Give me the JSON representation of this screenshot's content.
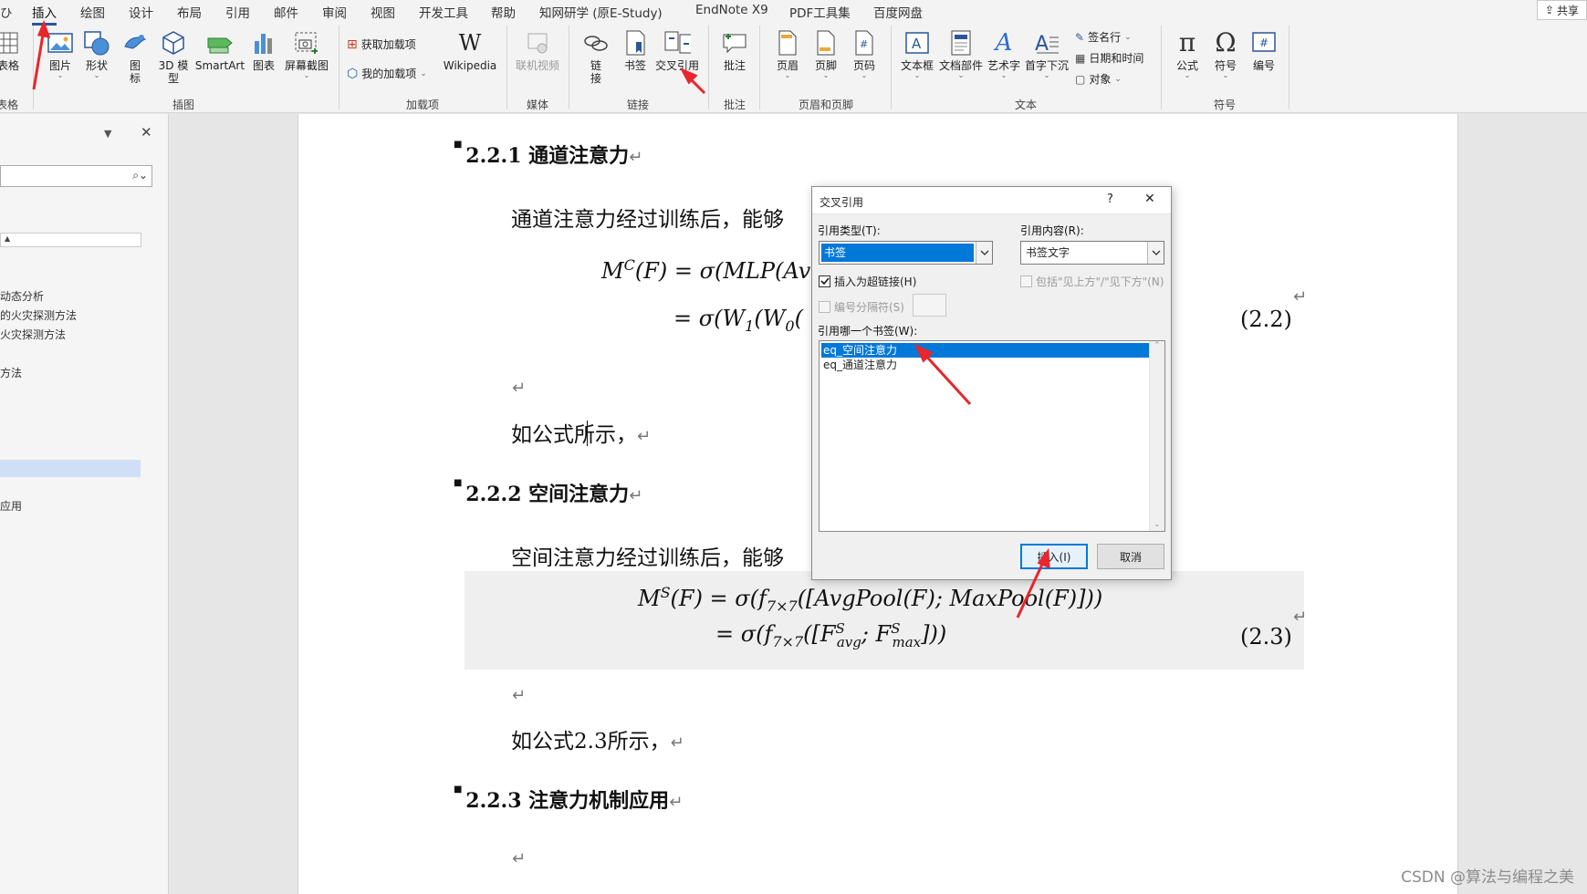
{
  "tabs": [
    "ひ",
    "插入",
    "绘图",
    "设计",
    "布局",
    "引用",
    "邮件",
    "审阅",
    "视图",
    "开发工具",
    "帮助",
    "知网研学 (原E-Study)",
    "EndNote X9",
    "PDF工具集",
    "百度网盘"
  ],
  "share_label": "共享",
  "ribbon": {
    "table_label": "表格",
    "picture_label": "图片",
    "shapes_label": "形状",
    "icons_label": "图标",
    "model3d_label": "3D 模型",
    "smartart_label": "SmartArt",
    "chart_label": "图表",
    "screenshot_label": "屏幕截图",
    "get_addins_label": "获取加载项",
    "my_addins_label": "我的加载项",
    "wikipedia_label": "Wikipedia",
    "online_video_label": "联机视频",
    "link_label": "链接",
    "bookmark_label": "书签",
    "crossref_label": "交叉引用",
    "comment_label": "批注",
    "header_label": "页眉",
    "footer_label": "页脚",
    "pagenum_label": "页码",
    "textbox_label": "文本框",
    "quickparts_label": "文档部件",
    "wordart_label": "艺术字",
    "dropcap_label": "首字下沉",
    "signature_label": "签名行",
    "datetime_label": "日期和时间",
    "object_label": "对象",
    "equation_label": "公式",
    "symbol_label": "符号",
    "numbering_label": "编号",
    "group_table": "表格",
    "group_illustrations": "插图",
    "group_addins": "加载项",
    "group_media": "媒体",
    "group_links": "链接",
    "group_comments": "批注",
    "group_headerfooter": "页眉和页脚",
    "group_text": "文本",
    "group_symbols": "符号"
  },
  "nav": {
    "items": [
      "动态分析",
      "的火灾探测方法",
      "火灾探测方法",
      "方法",
      "应用"
    ]
  },
  "doc": {
    "h1": "2.2.1 通道注意力",
    "p1": "通道注意力经过训练后，能够",
    "eq1_line1": "M",
    "eq1_sup": "C",
    "eq1_rest": "(F) = σ(MLP(Av",
    "eq1_line2": "= σ(W",
    "eq1_sub1": "1",
    "eq1_line2b": "(W",
    "eq1_sub0": "0",
    "eq1_line2c": "(",
    "eq1_no": "(2.2)",
    "p2": "如公式所示，",
    "h2": "2.2.2 空间注意力",
    "p3": "空间注意力经过训练后，能够",
    "eq2_line1": "M",
    "eq2_sup": "S",
    "eq2_rest": "(F) = σ(f",
    "eq2_sub": "7×7",
    "eq2_rest2": "([AvgPool(F); MaxPool(F)]))",
    "eq2_line2": "= σ(f",
    "eq2_line2b": "([F",
    "eq2_avg": "avg",
    "eq2_sep": "; F",
    "eq2_max": "max",
    "eq2_end": "]))",
    "eq2_no": "(2.3)",
    "p4": "如公式2.3所示，",
    "h3": "2.2.3 注意力机制应用"
  },
  "dialog": {
    "title": "交叉引用",
    "help": "?",
    "close": "✕",
    "ref_type_label": "引用类型(T):",
    "ref_type_value": "书签",
    "ref_content_label": "引用内容(R):",
    "ref_content_value": "书签文字",
    "hyperlink_label": "插入为超链接(H)",
    "include_label": "包括\"见上方\"/\"见下方\"(N)",
    "separator_label": "编号分隔符(S)",
    "which_label": "引用哪一个书签(W):",
    "bookmarks": [
      "eq_空间注意力",
      "eq_通道注意力"
    ],
    "insert_label": "插入(I)",
    "cancel_label": "取消"
  },
  "colors": {
    "ribbon_bg": "#f3f3f3",
    "accent": "#2b579a",
    "selection": "#0078d7",
    "annotation_arrow": "#e8262c"
  },
  "watermark": "CSDN @算法与编程之美"
}
